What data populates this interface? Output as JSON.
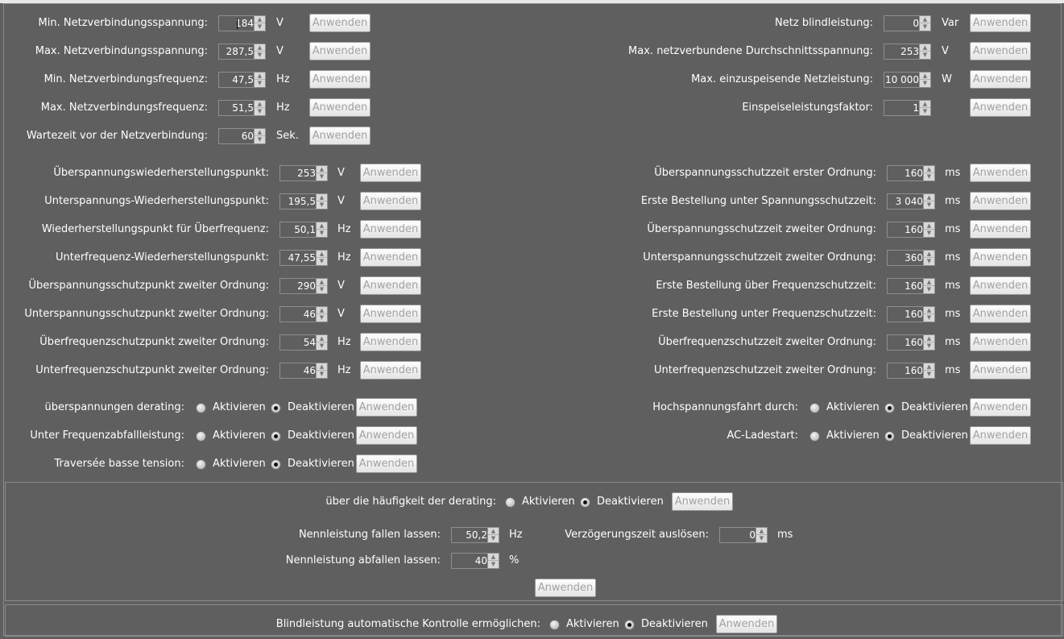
{
  "apply": "Anwenden",
  "activate": "Aktivieren",
  "deactivate": "Deaktivieren",
  "grid_left": [
    {
      "label": "Min. Netzverbindungsspannung:",
      "value": "184",
      "unit": "V"
    },
    {
      "label": "Max. Netzverbindungsspannung:",
      "value": "287,5",
      "unit": "V"
    },
    {
      "label": "Min. Netzverbindungsfrequenz:",
      "value": "47,5",
      "unit": "Hz"
    },
    {
      "label": "Max. Netzverbindungsfrequenz:",
      "value": "51,5",
      "unit": "Hz"
    },
    {
      "label": "Wartezeit vor der Netzverbindung:",
      "value": "60",
      "unit": "Sek."
    }
  ],
  "grid_right": [
    {
      "label": "Netz blindleistung:",
      "value": "0",
      "unit": "Var"
    },
    {
      "label": "Max. netzverbundene Durchschnittsspannung:",
      "value": "253",
      "unit": "V"
    },
    {
      "label": "Max. einzuspeisende Netzleistung:",
      "value": "10 000",
      "unit": "W"
    },
    {
      "label": "Einspeiseleistungsfaktor:",
      "value": "1",
      "unit": ""
    }
  ],
  "prot_left": [
    {
      "label": "Überspannungswiederherstellungspunkt:",
      "value": "253",
      "unit": "V"
    },
    {
      "label": "Unterspannungs-Wiederherstellungspunkt:",
      "value": "195,5",
      "unit": "V"
    },
    {
      "label": "Wiederherstellungspunkt für Überfrequenz:",
      "value": "50,1",
      "unit": "Hz"
    },
    {
      "label": "Unterfrequenz-Wiederherstellungspunkt:",
      "value": "47,55",
      "unit": "Hz"
    },
    {
      "label": "Überspannungsschutzpunkt zweiter Ordnung:",
      "value": "290",
      "unit": "V"
    },
    {
      "label": "Unterspannungsschutzpunkt zweiter Ordnung:",
      "value": "46",
      "unit": "V"
    },
    {
      "label": "Überfrequenzschutzpunkt zweiter Ordnung:",
      "value": "54",
      "unit": "Hz"
    },
    {
      "label": "Unterfrequenzschutzpunkt zweiter Ordnung:",
      "value": "46",
      "unit": "Hz"
    }
  ],
  "prot_right": [
    {
      "label": "Überspannungsschutzzeit erster Ordnung:",
      "value": "160",
      "unit": "ms"
    },
    {
      "label": "Erste Bestellung unter Spannungsschutzzeit:",
      "value": "3 040",
      "unit": "ms"
    },
    {
      "label": "Überspannungsschutzzeit zweiter Ordnung:",
      "value": "160",
      "unit": "ms"
    },
    {
      "label": "Unterspannungsschutzzeit zweiter Ordnung:",
      "value": "360",
      "unit": "ms"
    },
    {
      "label": "Erste Bestellung über Frequenzschutzzeit:",
      "value": "160",
      "unit": "ms"
    },
    {
      "label": "Erste Bestellung unter Frequenzschutzzeit:",
      "value": "160",
      "unit": "ms"
    },
    {
      "label": "Überfrequenzschutzzeit zweiter Ordnung:",
      "value": "160",
      "unit": "ms"
    },
    {
      "label": "Unterfrequenzschutzzeit zweiter Ordnung:",
      "value": "160",
      "unit": "ms"
    }
  ],
  "toggles_left": [
    {
      "label": "überspannungen derating:",
      "selected": "deactivate"
    },
    {
      "label": "Unter Frequenzabfallleistung:",
      "selected": "deactivate"
    },
    {
      "label": "Traversée basse tension:",
      "selected": "deactivate"
    }
  ],
  "toggles_right": [
    {
      "label": "Hochspannungsfahrt durch:",
      "selected": "deactivate"
    },
    {
      "label": "AC-Ladestart:",
      "selected": "deactivate"
    }
  ],
  "freq_derating": {
    "label": "über die häufigkeit der derating:",
    "selected": "deactivate",
    "nominal_drop_label": "Nennleistung fallen lassen:",
    "nominal_drop_value": "50,2",
    "nominal_drop_unit": "Hz",
    "delay_label": "Verzögerungszeit auslösen:",
    "delay_value": "0",
    "delay_unit": "ms",
    "nominal_fall_label": "Nennleistung abfallen lassen:",
    "nominal_fall_value": "40",
    "nominal_fall_unit": "%"
  },
  "reactive": {
    "label": "Blindleistung automatische Kontrolle ermöglichen:",
    "selected": "deactivate"
  }
}
